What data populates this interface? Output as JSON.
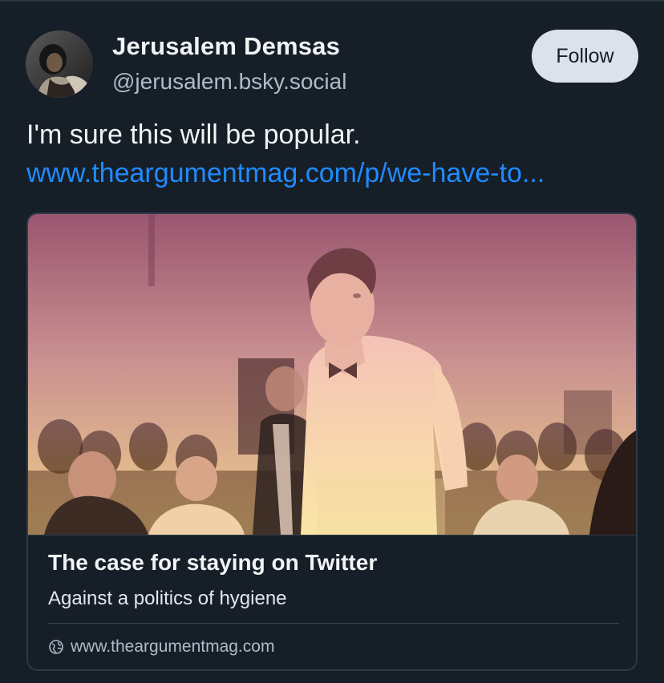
{
  "author": {
    "display_name": "Jerusalem Demsas",
    "handle": "@jerusalem.bsky.social",
    "avatar_icon": "profile-photo"
  },
  "follow_button": {
    "label": "Follow"
  },
  "post": {
    "text": "I'm sure this will be popular.",
    "link_text": "www.theargumentmag.com/p/we-have-to..."
  },
  "link_card": {
    "title": "The case for staying on Twitter",
    "description": "Against a politics of hygiene",
    "domain": "www.theargumentmag.com",
    "domain_icon": "globe-icon"
  },
  "colors": {
    "background": "#161e27",
    "text_primary": "#f1f3f5",
    "text_secondary": "#aebbc9",
    "link": "#208bfe",
    "button_bg": "#dce2ea",
    "card_border": "#2e3a48"
  }
}
